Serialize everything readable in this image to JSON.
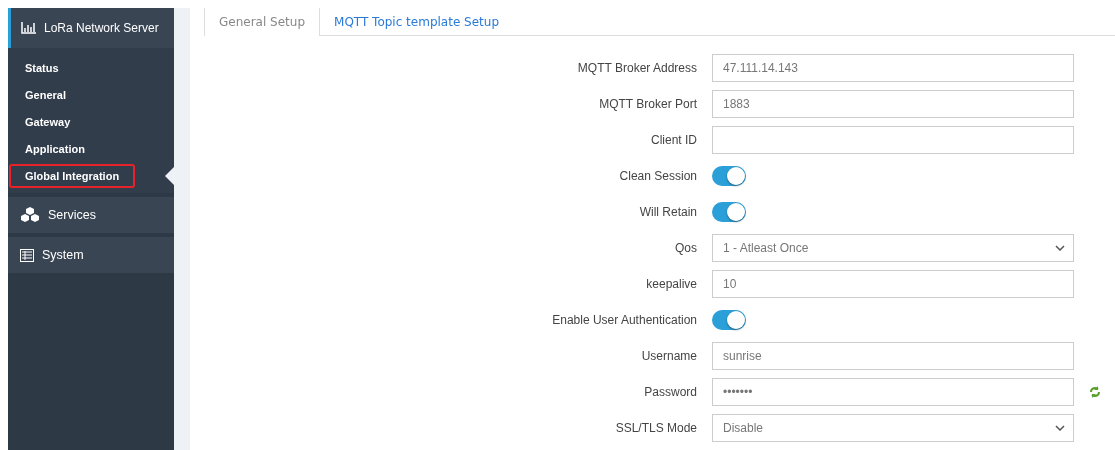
{
  "sidebar": {
    "header": {
      "label": "LoRa Network Server",
      "expanded": true
    },
    "items": [
      {
        "label": "Status",
        "selected": false
      },
      {
        "label": "General",
        "selected": false
      },
      {
        "label": "Gateway",
        "selected": false
      },
      {
        "label": "Application",
        "selected": false
      },
      {
        "label": "Global Integration",
        "selected": true
      }
    ],
    "sections": [
      {
        "label": "Services",
        "kind": "services"
      },
      {
        "label": "System",
        "kind": "system"
      }
    ]
  },
  "tabs": [
    {
      "label": "General Setup",
      "selected": true
    },
    {
      "label": "MQTT Topic template Setup",
      "selected": false
    }
  ],
  "form": [
    {
      "kind": "text",
      "label": "MQTT Broker Address",
      "value": "47.111.14.143"
    },
    {
      "kind": "text",
      "label": "MQTT Broker Port",
      "value": "1883"
    },
    {
      "kind": "text",
      "label": "Client ID"
    },
    {
      "kind": "toggle",
      "label": "Clean Session",
      "on": true
    },
    {
      "kind": "toggle",
      "label": "Will Retain",
      "on": true
    },
    {
      "kind": "select",
      "label": "Qos",
      "value": "1 - Atleast Once"
    },
    {
      "kind": "text",
      "label": "keepalive",
      "value": "10"
    },
    {
      "kind": "toggle",
      "label": "Enable User Authentication",
      "on": true
    },
    {
      "kind": "text",
      "label": "Username",
      "value": "sunrise"
    },
    {
      "kind": "password",
      "label": "Password",
      "value": "•••••••"
    },
    {
      "kind": "select",
      "label": "SSL/TLS Mode",
      "value": "Disable"
    }
  ]
}
